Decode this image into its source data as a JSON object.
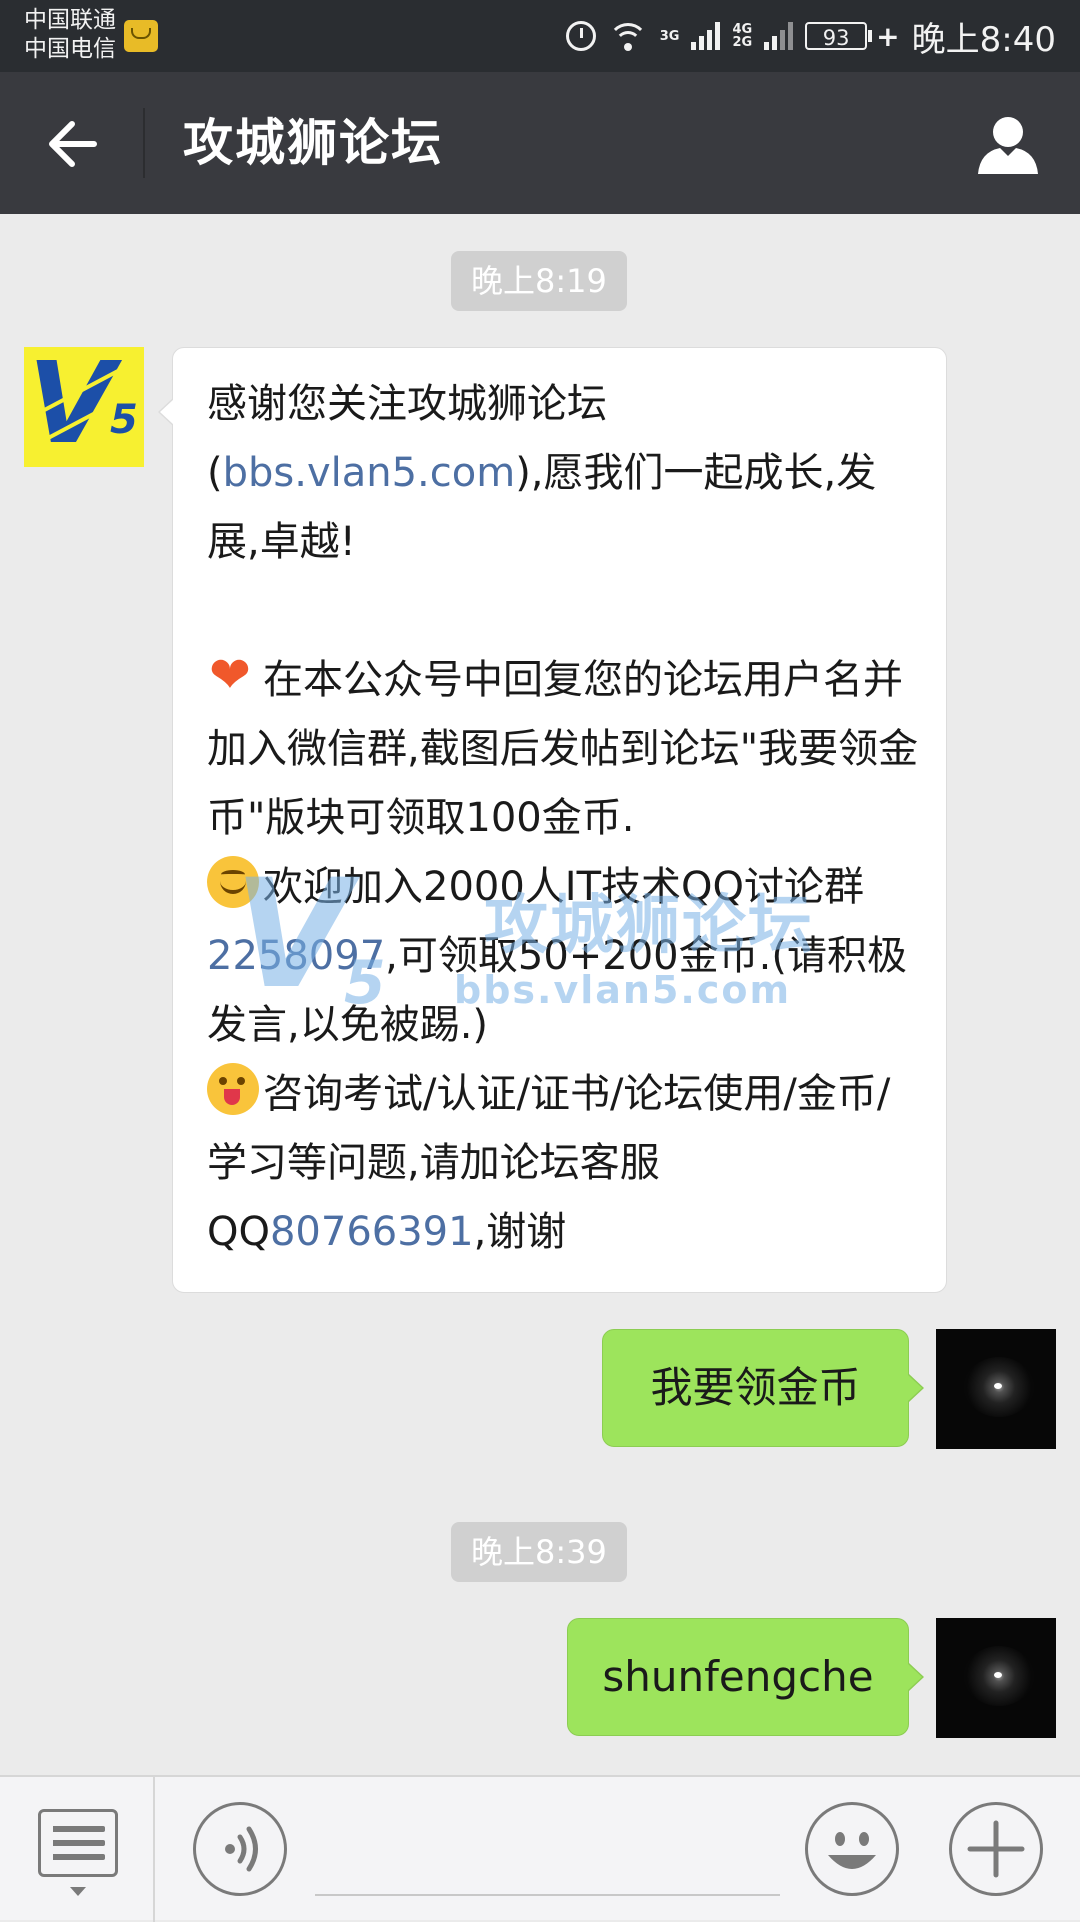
{
  "status_bar": {
    "carrier_1": "中国联通",
    "carrier_2": "中国电信",
    "network_1": "3G",
    "network_2_line1": "4G",
    "network_2_line2": "2G",
    "battery": "93",
    "time": "晚上8:40"
  },
  "title_bar": {
    "title": "攻城狮论坛",
    "back_icon": "arrow-left-icon",
    "profile_icon": "person-icon"
  },
  "chat": {
    "timestamps": [
      "晚上8:19",
      "晚上8:39"
    ],
    "incoming": {
      "line1_pre": "感谢您关注攻城狮论坛(",
      "line1_link": "bbs.vlan5.com",
      "line1_post": "),愿我们一起成长,发展,卓越!",
      "para2": "在本公众号中回复您的论坛用户名并加入微信群,截图后发帖到论坛\"我要领金币\"版块可领取100金币.",
      "para3_pre": "欢迎加入2000人IT技术QQ讨论群",
      "para3_link": "2258097",
      "para3_post": ",可领取50+200金币.(请积极发言,以免被踢.)",
      "para4_pre": "咨询考试/认证/证书/论坛使用/金币/学习等问题,请加论坛客服QQ",
      "para4_link": "80766391",
      "para4_post": ",谢谢"
    },
    "watermark": {
      "brand_v": "V",
      "brand_5": "5",
      "name": "攻城狮论坛",
      "url": "bbs.vlan5.com"
    },
    "avatar_v": "V",
    "avatar_5": "5",
    "outgoing": [
      "我要领金币",
      "shunfengche"
    ]
  },
  "input_bar": {
    "icons": [
      "menu-list-icon",
      "voice-icon",
      "emoji-icon",
      "plus-icon"
    ]
  },
  "colors": {
    "status_bar": "#2a2d31",
    "title_bar": "#393a3f",
    "chat_bg": "#ebebeb",
    "outgoing_bubble": "#9de45c",
    "link": "#4d6fa3"
  }
}
